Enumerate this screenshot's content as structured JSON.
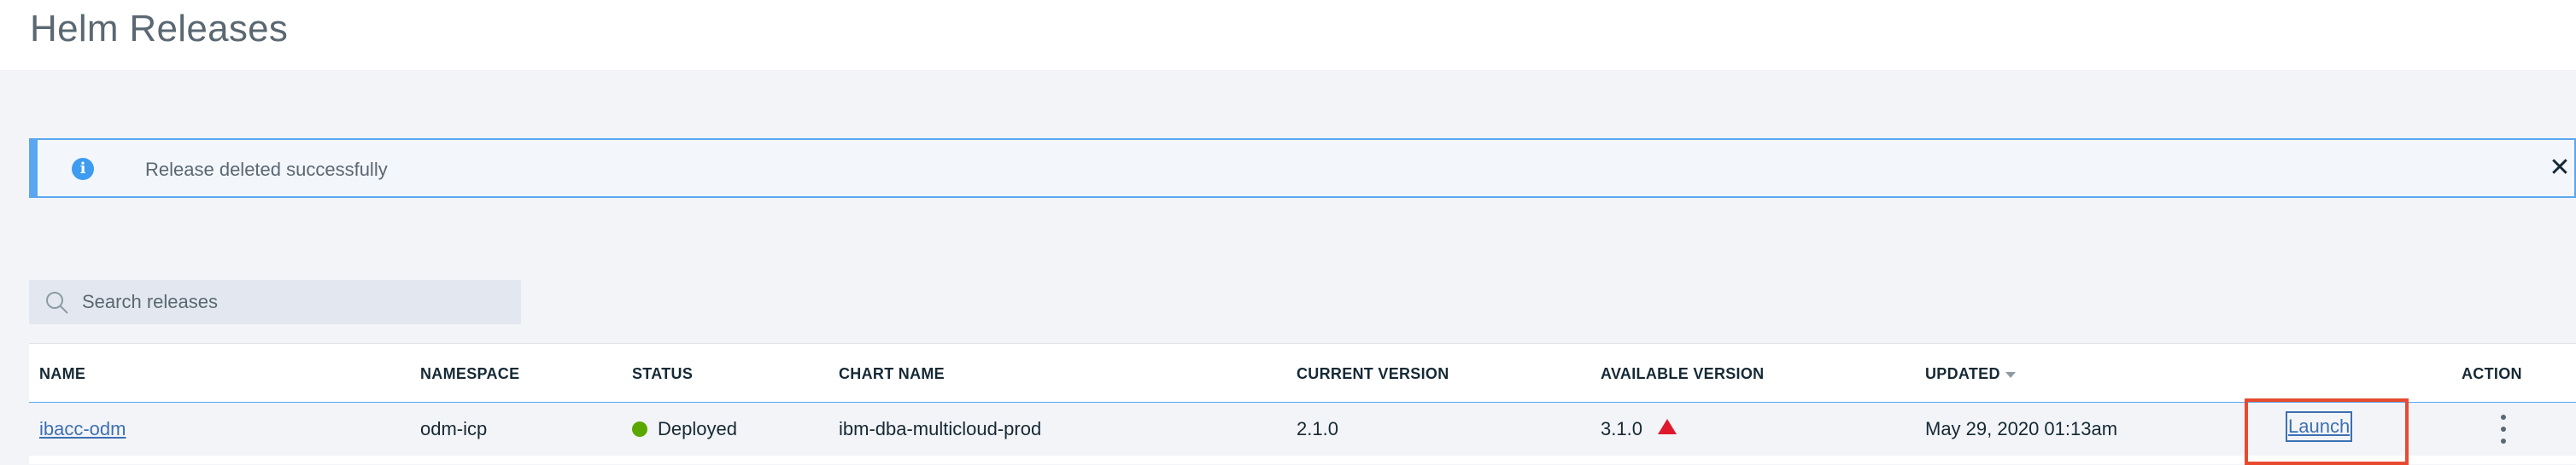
{
  "page": {
    "title": "Helm Releases"
  },
  "notification": {
    "type": "info",
    "message": "Release deleted successfully",
    "icon": "info-icon",
    "close_icon": "close-icon"
  },
  "search": {
    "placeholder": "Search releases",
    "value": ""
  },
  "table": {
    "columns": [
      "NAME",
      "NAMESPACE",
      "STATUS",
      "CHART NAME",
      "CURRENT VERSION",
      "AVAILABLE VERSION",
      "UPDATED",
      "",
      "ACTION"
    ],
    "sorted_column": "UPDATED",
    "rows": [
      {
        "name": "ibacc-odm",
        "namespace": "odm-icp",
        "status": "Deployed",
        "chart_name": "ibm-dba-multicloud-prod",
        "current_version": "2.1.0",
        "available_version": "3.1.0",
        "updated": "May 29, 2020 01:13am",
        "launch": "Launch"
      }
    ]
  },
  "colors": {
    "accent": "#5aa7f0",
    "link": "#3d70b2",
    "status_ok": "#5aa700",
    "upgrade_warning": "#e0182d",
    "highlight_box": "#e84a2f"
  }
}
